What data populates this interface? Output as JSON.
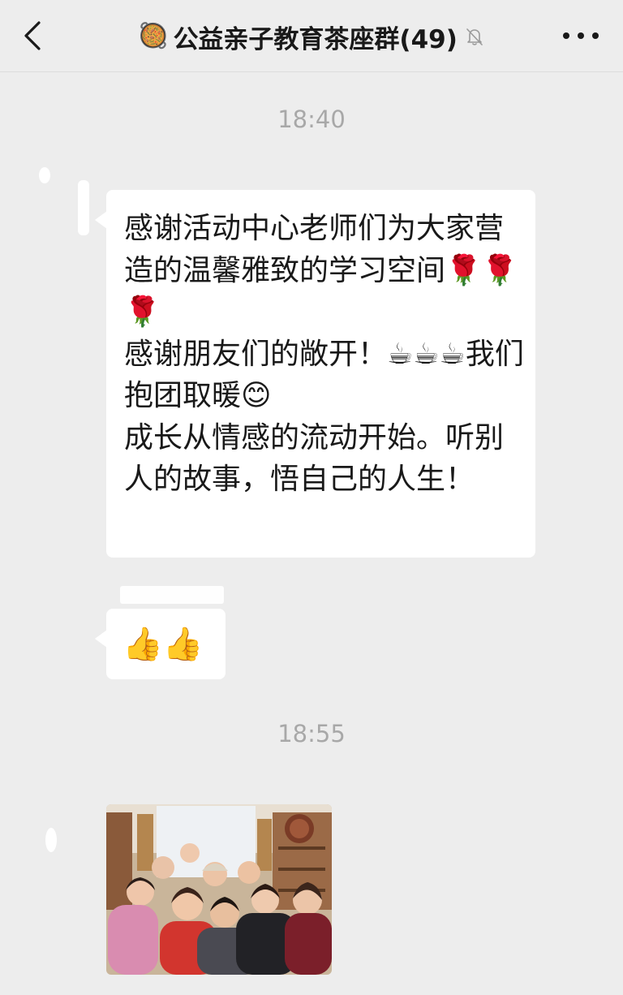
{
  "header": {
    "title_emoji": "🥘",
    "title": "公益亲子教育茶座群(49)",
    "back_icon": "chevron-left-icon",
    "mute_icon": "bell-off-icon",
    "more_icon": "ellipsis-icon"
  },
  "timestamps": [
    "18:40",
    "18:55"
  ],
  "messages": [
    {
      "type": "text",
      "text": "感谢活动中心老师们为大家营造的温馨雅致的学习空间🌹🌹🌹\n感谢朋友们的敞开！☕☕☕我们抱团取暖😊\n成长从情感的流动开始。听别人的故事，悟自己的人生！"
    },
    {
      "type": "text",
      "text": "👍👍"
    },
    {
      "type": "image",
      "description_icon": "group-photo"
    }
  ],
  "colors": {
    "background": "#ededed",
    "bubble": "#ffffff",
    "text": "#191919",
    "timestamp": "#a8a8a8"
  }
}
